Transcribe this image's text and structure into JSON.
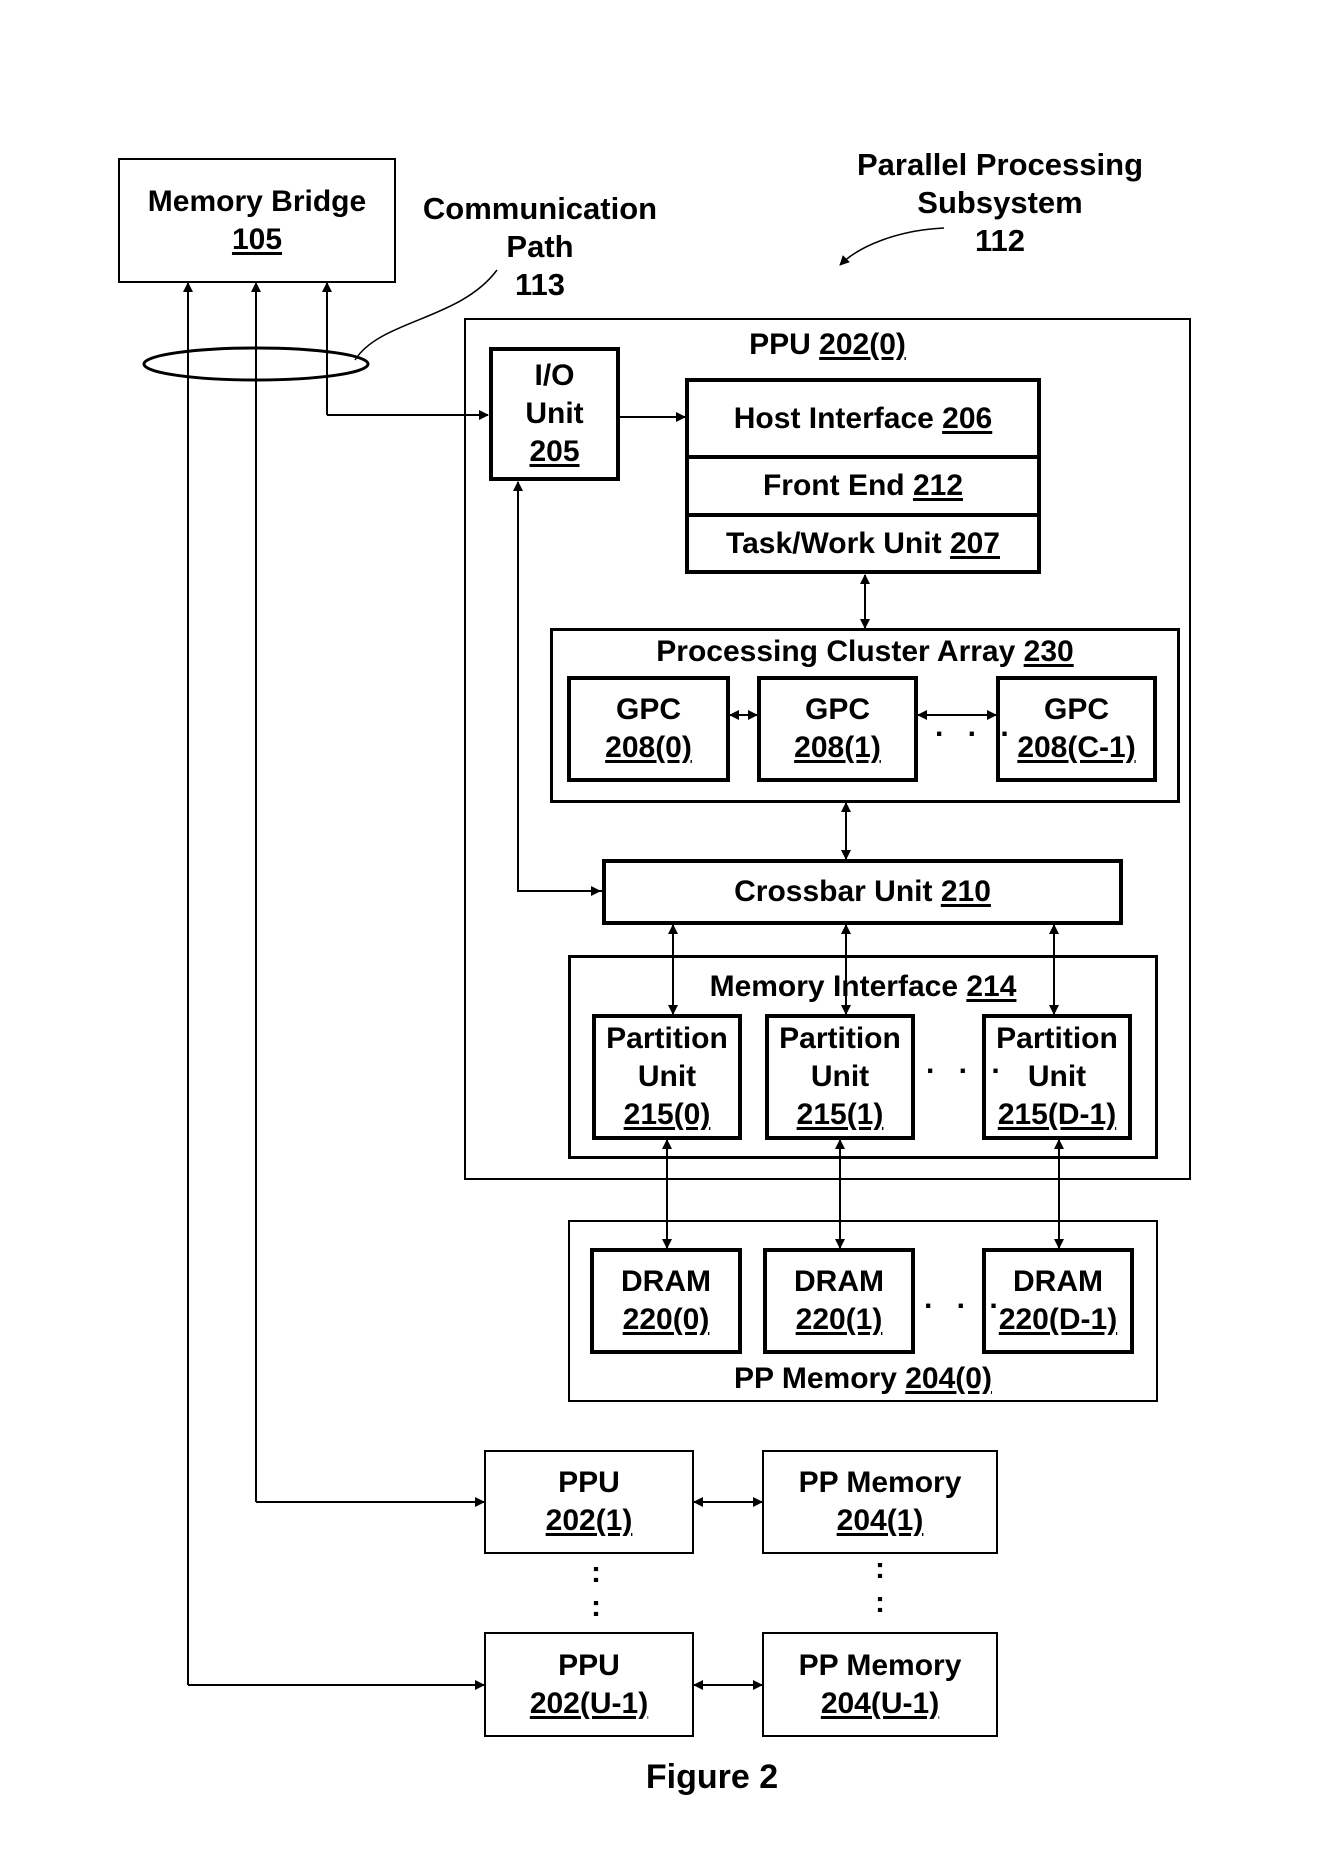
{
  "figure_caption": "Figure 2",
  "callouts": {
    "communication_path": {
      "line1": "Communication",
      "line2": "Path",
      "ref": "113"
    },
    "pps": {
      "line1": "Parallel Processing",
      "line2": "Subsystem",
      "ref": "112"
    }
  },
  "memory_bridge": {
    "name": "Memory Bridge",
    "ref": "105"
  },
  "ppu0": {
    "name": "PPU",
    "ref": "202(0)",
    "io_unit": {
      "line1": "I/O",
      "line2": "Unit",
      "ref": "205"
    },
    "host_interface": {
      "name": "Host Interface",
      "ref": "206"
    },
    "front_end": {
      "name": "Front End",
      "ref": "212"
    },
    "task_work_unit": {
      "name": "Task/Work Unit",
      "ref": "207"
    },
    "pca": {
      "name": "Processing Cluster Array",
      "ref": "230",
      "gpcs": [
        {
          "name": "GPC",
          "ref": "208(0)"
        },
        {
          "name": "GPC",
          "ref": "208(1)"
        },
        {
          "name": "GPC",
          "ref": "208(C-1)"
        }
      ],
      "ellipsis": ". . ."
    },
    "crossbar": {
      "name": "Crossbar Unit",
      "ref": "210"
    },
    "memory_interface": {
      "name": "Memory Interface",
      "ref": "214",
      "partitions": [
        {
          "line1": "Partition",
          "line2": "Unit",
          "ref": "215(0)"
        },
        {
          "line1": "Partition",
          "line2": "Unit",
          "ref": "215(1)"
        },
        {
          "line1": "Partition",
          "line2": "Unit",
          "ref": "215(D-1)"
        }
      ],
      "ellipsis": ". . ."
    }
  },
  "pp_memory0": {
    "name": "PP Memory",
    "ref": "204(0)",
    "drams": [
      {
        "name": "DRAM",
        "ref": "220(0)"
      },
      {
        "name": "DRAM",
        "ref": "220(1)"
      },
      {
        "name": "DRAM",
        "ref": "220(D-1)"
      }
    ],
    "ellipsis": ". . ."
  },
  "ppu1": {
    "name": "PPU",
    "ref": "202(1)"
  },
  "pp_memory1": {
    "name": "PP Memory",
    "ref": "204(1)"
  },
  "ppu_last": {
    "name": "PPU",
    "ref": "202(U-1)"
  },
  "pp_memory_last": {
    "name": "PP Memory",
    "ref": "204(U-1)"
  },
  "vertical_ellipsis": ":"
}
